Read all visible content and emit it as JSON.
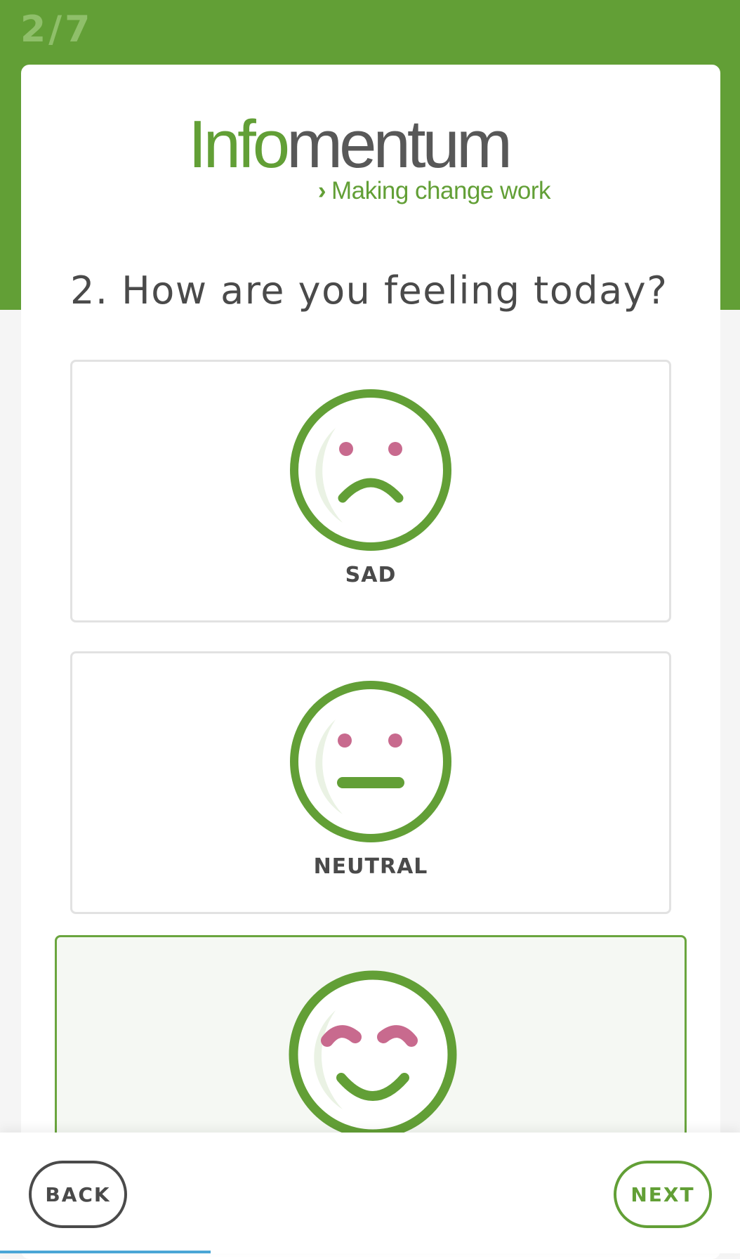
{
  "progress": {
    "text": "2/7"
  },
  "logo": {
    "word_part1": "Info",
    "word_part2": "mentum",
    "tagline": "Making change work",
    "chevron_icon": "chevron-right-icon"
  },
  "question": {
    "text": "2. How are you feeling today?"
  },
  "options": [
    {
      "label": "SAD",
      "icon": "sad-face-icon",
      "selected": false
    },
    {
      "label": "NEUTRAL",
      "icon": "neutral-face-icon",
      "selected": false
    },
    {
      "label": "",
      "icon": "happy-face-icon",
      "selected": true
    }
  ],
  "navigation": {
    "back_label": "BACK",
    "next_label": "NEXT"
  },
  "colors": {
    "brand_green": "#629f36",
    "eye_pink": "#c86a8e",
    "text_dark": "#4a4a4a",
    "card_border": "#e2e2e2",
    "selected_bg": "#f5f8f3"
  }
}
